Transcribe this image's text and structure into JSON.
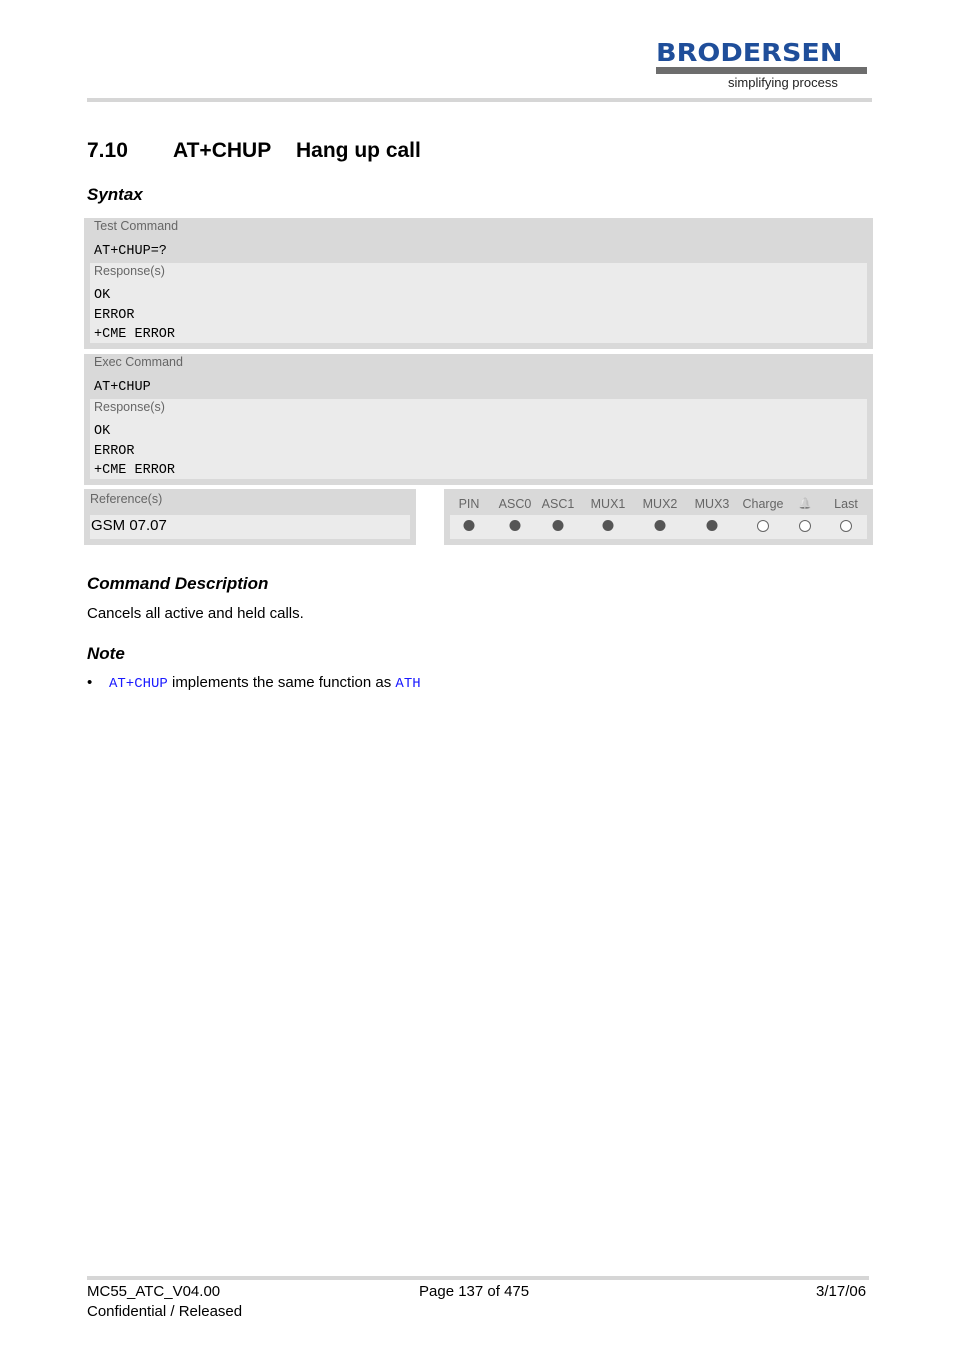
{
  "header": {
    "logo": "BRODERSEN",
    "tagline": "simplifying process"
  },
  "section": {
    "number": "7.10",
    "command": "AT+CHUP",
    "title": "Hang up call"
  },
  "syntax": {
    "heading": "Syntax",
    "test": {
      "label": "Test Command",
      "command": "AT+CHUP=?",
      "response_label": "Response(s)",
      "responses": [
        "OK",
        "ERROR",
        "+CME ERROR"
      ]
    },
    "exec": {
      "label": "Exec Command",
      "command": "AT+CHUP",
      "response_label": "Response(s)",
      "responses": [
        "OK",
        "ERROR",
        "+CME ERROR"
      ]
    },
    "reference": {
      "label": "Reference(s)",
      "value": "GSM 07.07"
    },
    "flags": [
      {
        "name": "PIN",
        "on": true
      },
      {
        "name": "ASC0",
        "on": true
      },
      {
        "name": "ASC1",
        "on": true
      },
      {
        "name": "MUX1",
        "on": true
      },
      {
        "name": "MUX2",
        "on": true
      },
      {
        "name": "MUX3",
        "on": true
      },
      {
        "name": "Charge",
        "on": false
      },
      {
        "name": "",
        "icon": "alarm-bell-icon",
        "on": false
      },
      {
        "name": "Last",
        "on": false
      }
    ]
  },
  "description": {
    "heading": "Command Description",
    "text": "Cancels all active and held calls."
  },
  "note": {
    "heading": "Note",
    "bullet": "•",
    "link1": "AT+CHUP",
    "text": " implements the same function as ",
    "link2": "ATH"
  },
  "footer": {
    "doc": "MC55_ATC_V04.00",
    "status": "Confidential / Released",
    "page": "Page 137 of 475",
    "date": "3/17/06"
  }
}
